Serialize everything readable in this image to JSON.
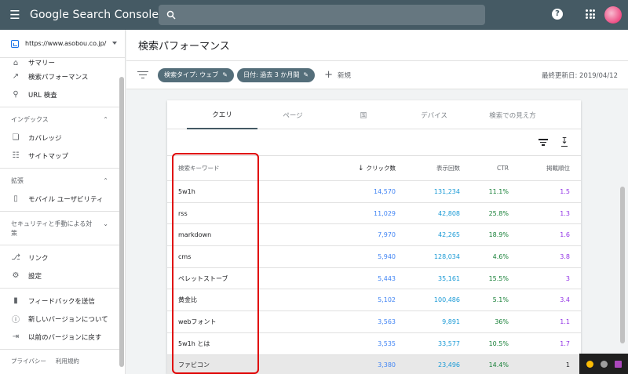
{
  "app": {
    "title": "Google Search Console",
    "avatar_color": "#e91e63"
  },
  "sidebar": {
    "property": "https://www.asobou.co.jp/",
    "partial_item": "サマリー",
    "items_top": [
      {
        "label": "検索パフォーマンス",
        "icon": "trending-up-icon"
      },
      {
        "label": "URL 検査",
        "icon": "search-icon"
      }
    ],
    "sections": [
      {
        "title": "インデックス",
        "items": [
          {
            "label": "カバレッジ",
            "icon": "copy-icon"
          },
          {
            "label": "サイトマップ",
            "icon": "sitemap-icon"
          }
        ]
      },
      {
        "title": "拡張",
        "items": [
          {
            "label": "モバイル ユーザビリティ",
            "icon": "phone-icon"
          }
        ]
      },
      {
        "title": "セキュリティと手動による対策",
        "items": []
      }
    ],
    "items_bottom": [
      {
        "label": "リンク",
        "icon": "links-icon"
      },
      {
        "label": "設定",
        "icon": "gear-icon"
      }
    ],
    "items_feedback": [
      {
        "label": "フィードバックを送信",
        "icon": "feedback-icon"
      },
      {
        "label": "新しいバージョンについて",
        "icon": "info-icon"
      },
      {
        "label": "以前のバージョンに戻す",
        "icon": "exit-icon"
      }
    ],
    "footer": {
      "privacy": "プライバシー",
      "terms": "利用規約"
    }
  },
  "page": {
    "title": "検索パフォーマンス"
  },
  "filters": {
    "chips": [
      "検索タイプ: ウェブ",
      "日付: 過去 3 か月間"
    ],
    "new_label": "新規",
    "updated": "最終更新日: 2019/04/12"
  },
  "tabs": [
    "クエリ",
    "ページ",
    "国",
    "デバイス",
    "検索での見え方"
  ],
  "table": {
    "headers": {
      "keyword": "検索キーワード",
      "clicks": "クリック数",
      "impressions": "表示回数",
      "ctr": "CTR",
      "position": "掲載順位"
    },
    "rows": [
      {
        "keyword": "5w1h",
        "clicks": "14,570",
        "impressions": "131,234",
        "ctr": "11.1%",
        "position": "1.5"
      },
      {
        "keyword": "rss",
        "clicks": "11,029",
        "impressions": "42,808",
        "ctr": "25.8%",
        "position": "1.3"
      },
      {
        "keyword": "markdown",
        "clicks": "7,970",
        "impressions": "42,265",
        "ctr": "18.9%",
        "position": "1.6"
      },
      {
        "keyword": "cms",
        "clicks": "5,940",
        "impressions": "128,034",
        "ctr": "4.6%",
        "position": "3.8"
      },
      {
        "keyword": "ペレットストーブ",
        "clicks": "5,443",
        "impressions": "35,161",
        "ctr": "15.5%",
        "position": "3"
      },
      {
        "keyword": "黄金比",
        "clicks": "5,102",
        "impressions": "100,486",
        "ctr": "5.1%",
        "position": "3.4"
      },
      {
        "keyword": "webフォント",
        "clicks": "3,563",
        "impressions": "9,891",
        "ctr": "36%",
        "position": "1.1"
      },
      {
        "keyword": "5w1h とは",
        "clicks": "3,535",
        "impressions": "33,577",
        "ctr": "10.5%",
        "position": "1.7"
      },
      {
        "keyword": "ファビコン",
        "clicks": "3,380",
        "impressions": "23,496",
        "ctr": "14.4%",
        "position": "1"
      }
    ]
  }
}
